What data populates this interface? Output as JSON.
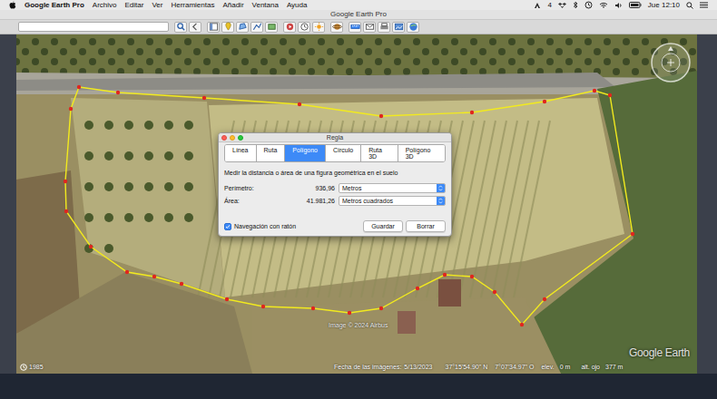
{
  "menu_bar": {
    "app": "Google Earth Pro",
    "items": [
      "Archivo",
      "Editar",
      "Ver",
      "Herramientas",
      "Añadir",
      "Ventana",
      "Ayuda"
    ],
    "badge": "4",
    "clock": "Jue 12:10"
  },
  "window": {
    "title": "Google Earth Pro"
  },
  "map": {
    "image_credit": "Image © 2024 Airbus",
    "logo": "Google Earth",
    "year": "1985",
    "status_bar": {
      "date_label": "Fecha de las imágenes:",
      "date": "5/13/2023",
      "latitude": "37°15'54.90\" N",
      "longitude": "7°07'34.97\" O",
      "elevation_label": "elev.",
      "elevation": "0 m",
      "eye_label": "alt. ojo",
      "eye_altitude": "377 m"
    }
  },
  "ruler": {
    "title": "Regla",
    "tabs": [
      {
        "label": "Línea",
        "selected": false
      },
      {
        "label": "Ruta",
        "selected": false
      },
      {
        "label": "Polígono",
        "selected": true
      },
      {
        "label": "Círculo",
        "selected": false
      },
      {
        "label": "Ruta 3D",
        "selected": false
      },
      {
        "label": "Polígono 3D",
        "selected": false
      }
    ],
    "description": "Medir la distancia o área de una figura geométrica en el suelo",
    "measures": [
      {
        "label": "Perímetro:",
        "value": "936,96",
        "unit": "Metros"
      },
      {
        "label": "Área:",
        "value": "41.981,26",
        "unit": "Metros cuadrados"
      }
    ],
    "mouse_navigation": {
      "label": "Navegación con ratón",
      "checked": true
    },
    "buttons": [
      "Guardar",
      "Borrar"
    ]
  }
}
